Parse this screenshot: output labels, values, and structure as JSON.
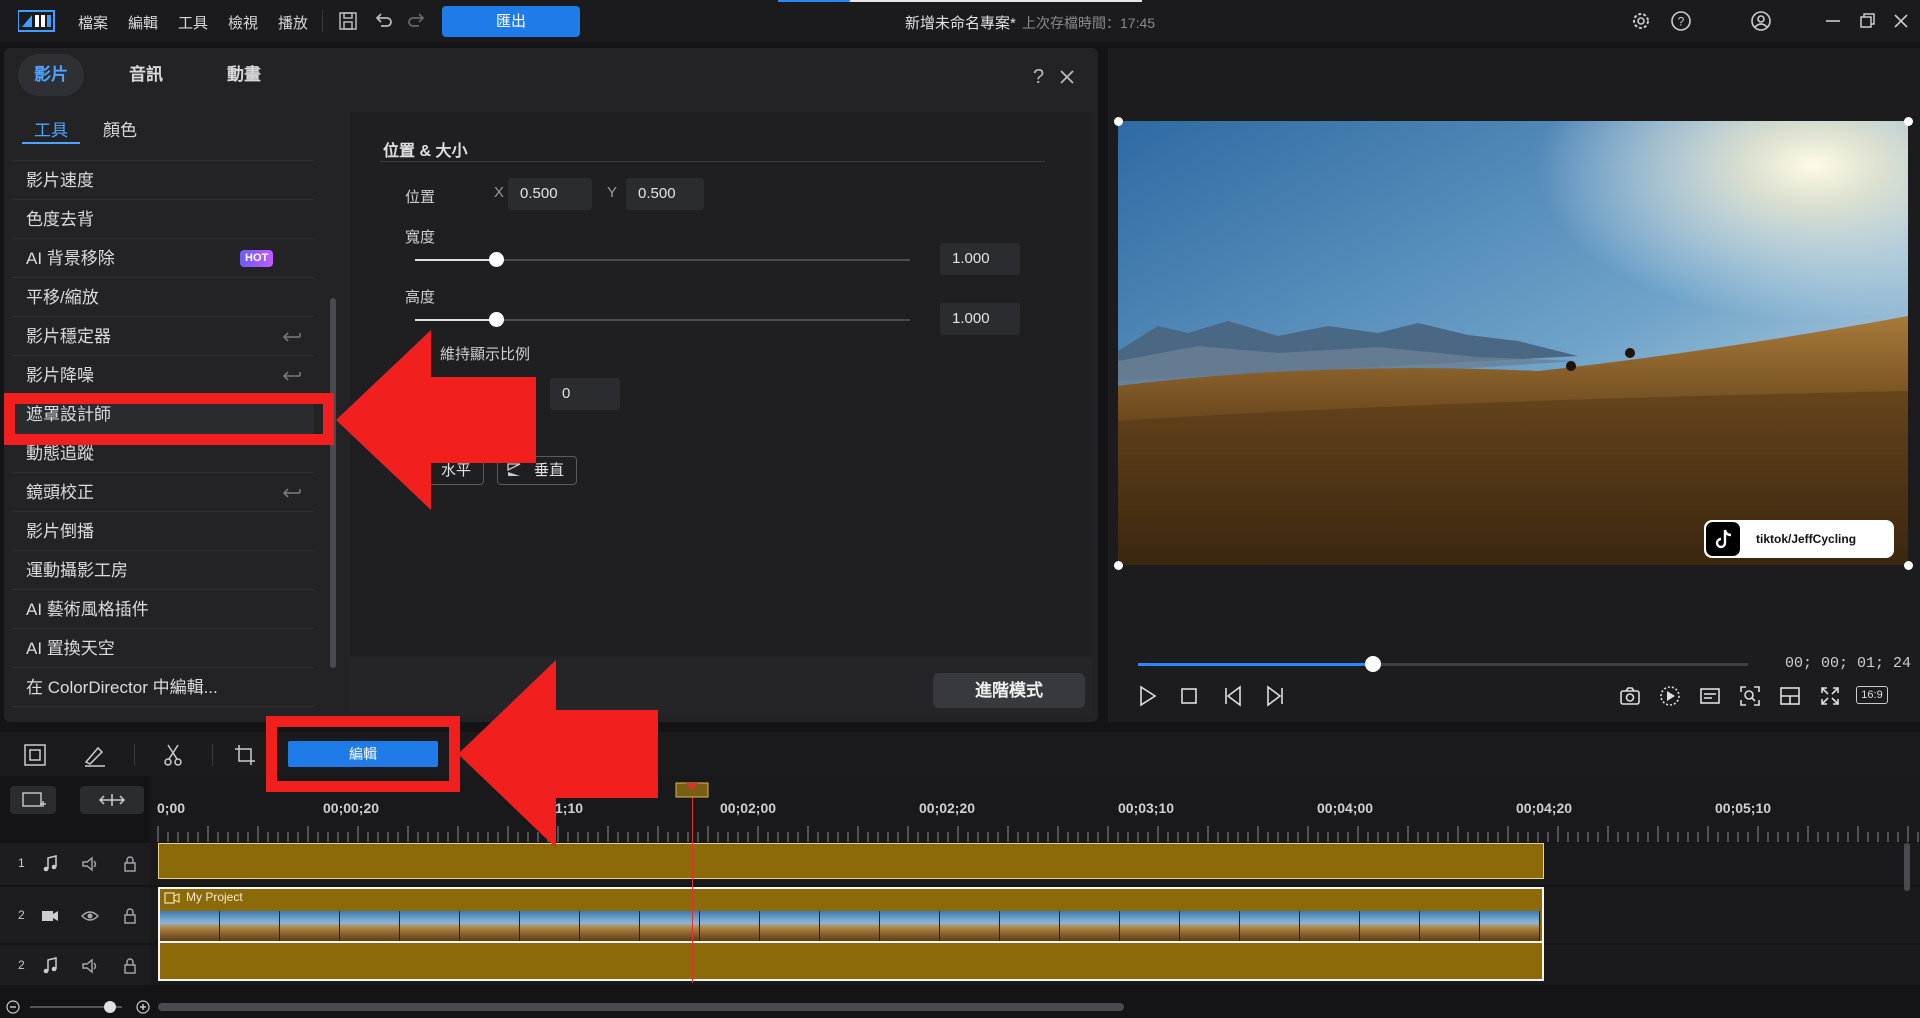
{
  "topbar": {
    "menus": [
      "檔案",
      "編輯",
      "工具",
      "檢視",
      "播放"
    ],
    "export_label": "匯出",
    "project_title": "新增未命名專案*",
    "saved_text": "上次存檔時間：17:45"
  },
  "panel": {
    "tabs": [
      "影片",
      "音訊",
      "動畫"
    ],
    "active_tab": 0,
    "sub_tabs": [
      "工具",
      "顏色"
    ],
    "tools": [
      {
        "label": "影片速度",
        "badge": null,
        "undo": false
      },
      {
        "label": "色度去背",
        "badge": null,
        "undo": false
      },
      {
        "label": "AI 背景移除",
        "badge": "HOT",
        "undo": false
      },
      {
        "label": "平移/縮放",
        "badge": null,
        "undo": false
      },
      {
        "label": "影片穩定器",
        "badge": null,
        "undo": true
      },
      {
        "label": "影片降噪",
        "badge": null,
        "undo": true
      },
      {
        "label": "遮罩設計師",
        "badge": null,
        "undo": false
      },
      {
        "label": "動態追蹤",
        "badge": null,
        "undo": false
      },
      {
        "label": "鏡頭校正",
        "badge": null,
        "undo": true
      },
      {
        "label": "影片倒播",
        "badge": null,
        "undo": false
      },
      {
        "label": "運動攝影工房",
        "badge": null,
        "undo": false
      },
      {
        "label": "AI 藝術風格插件",
        "badge": null,
        "undo": false
      },
      {
        "label": "AI 置換天空",
        "badge": null,
        "undo": false
      },
      {
        "label": "在 ColorDirector 中編輯...",
        "badge": null,
        "undo": false
      }
    ],
    "settings": {
      "section_title": "位置 & 大小",
      "position_label": "位置",
      "x_label": "X",
      "x_value": "0.500",
      "y_label": "Y",
      "y_value": "0.500",
      "width_label": "寬度",
      "width_value": "1.000",
      "height_label": "高度",
      "height_value": "1.000",
      "keep_ratio_label": "維持顯示比例",
      "rotation_value": "0",
      "flip_h": "水平",
      "flip_v": "垂直",
      "advanced_label": "進階模式"
    }
  },
  "preview": {
    "watermark": "tiktok/JeffCycling",
    "timecode": "00; 00; 01; 24",
    "aspect": "16:9",
    "progress": 0.39
  },
  "timeline": {
    "edit_label": "編輯",
    "ruler_labels": [
      "0;00",
      "00;00;20",
      "1;10",
      "00;02;00",
      "00;02;20",
      "00;03;10",
      "00;04;00",
      "00;04;20",
      "00;05;10"
    ],
    "tracks": [
      {
        "num": "1",
        "type": "audio"
      },
      {
        "num": "2",
        "type": "video"
      },
      {
        "num": "2",
        "type": "audio"
      }
    ],
    "clip_label": "My Project"
  },
  "colors": {
    "accent": "#1f7be8",
    "clip": "#8c6a0a",
    "highlight": "#f21f1f"
  }
}
